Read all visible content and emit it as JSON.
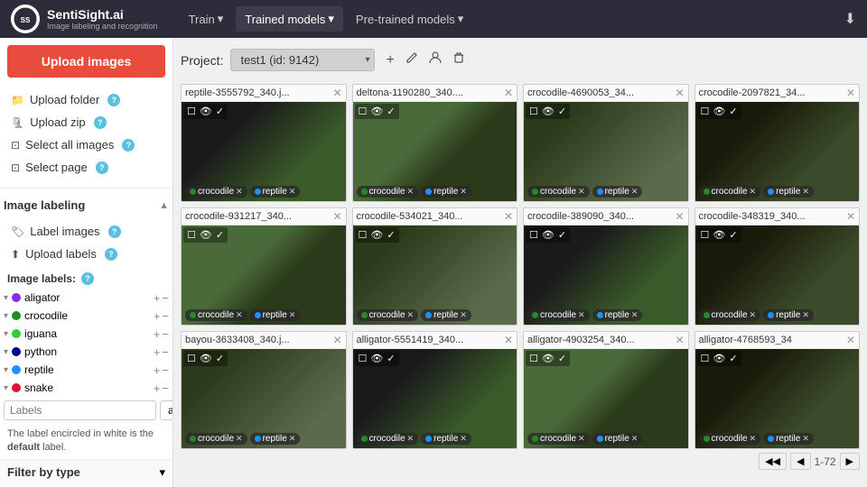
{
  "app": {
    "title": "SentiSight.ai",
    "subtitle": "Image labeling and recognition",
    "logo_text": "SS"
  },
  "navbar": {
    "items": [
      {
        "label": "Train",
        "id": "train",
        "active": false
      },
      {
        "label": "Trained models",
        "id": "trained-models",
        "active": true
      },
      {
        "label": "Pre-trained models",
        "id": "pretrained-models",
        "active": false
      }
    ],
    "download_icon": "⬇"
  },
  "sidebar": {
    "upload_btn": "Upload images",
    "items": [
      {
        "id": "upload-folder",
        "icon": "📁",
        "label": "Upload folder",
        "has_help": true
      },
      {
        "id": "upload-zip",
        "icon": "🗜",
        "label": "Upload zip",
        "has_help": true
      },
      {
        "id": "select-all-images",
        "icon": "⊡",
        "label": "Select all images",
        "has_help": true
      },
      {
        "id": "select-page",
        "icon": "⊡",
        "label": "Select page",
        "has_help": true
      }
    ],
    "image_labeling_section": "Image labeling",
    "label_images": "Label images",
    "upload_labels": "Upload labels",
    "image_labels_header": "Image labels:",
    "labels": [
      {
        "id": "aligator",
        "name": "aligator",
        "color": "#8a2be2"
      },
      {
        "id": "crocodile",
        "name": "crocodile",
        "color": "#228b22"
      },
      {
        "id": "iguana",
        "name": "iguana",
        "color": "#32cd32"
      },
      {
        "id": "python",
        "name": "python",
        "color": "#00008b"
      },
      {
        "id": "reptile",
        "name": "reptile",
        "color": "#1e90ff"
      },
      {
        "id": "snake",
        "name": "snake",
        "color": "#dc143c"
      }
    ],
    "labels_placeholder": "Labels",
    "labels_add_btn": "add",
    "default_label_note": "The label encircled in white is the",
    "default_label_keyword": "default",
    "default_label_note2": "label.",
    "filter_section_label": "Filter by type"
  },
  "project_bar": {
    "label": "Project:",
    "current": "test1 (id: 9142)",
    "add_icon": "+",
    "edit_icon": "✏",
    "user_icon": "👤",
    "delete_icon": "🗑"
  },
  "images": [
    {
      "id": "img1",
      "title": "reptile-3555792_340.j...",
      "bg_class": "img-croc1",
      "tags": [
        {
          "label": "crocodile",
          "color": "#228b22"
        },
        {
          "label": "reptile",
          "color": "#1e90ff"
        }
      ]
    },
    {
      "id": "img2",
      "title": "deltona-1190280_340....",
      "bg_class": "img-croc2",
      "tags": [
        {
          "label": "crocodile",
          "color": "#228b22"
        },
        {
          "label": "reptile",
          "color": "#1e90ff"
        }
      ]
    },
    {
      "id": "img3",
      "title": "crocodile-4690053_34...",
      "bg_class": "img-croc3",
      "tags": [
        {
          "label": "crocodile",
          "color": "#228b22"
        },
        {
          "label": "reptile",
          "color": "#1e90ff"
        }
      ]
    },
    {
      "id": "img4",
      "title": "crocodile-2097821_34...",
      "bg_class": "img-croc4",
      "tags": [
        {
          "label": "crocodile",
          "color": "#228b22"
        },
        {
          "label": "reptile",
          "color": "#1e90ff"
        }
      ]
    },
    {
      "id": "img5",
      "title": "crocodile-931217_340...",
      "bg_class": "img-croc2",
      "tags": [
        {
          "label": "crocodile",
          "color": "#228b22"
        },
        {
          "label": "reptile",
          "color": "#1e90ff"
        }
      ]
    },
    {
      "id": "img6",
      "title": "crocodile-534021_340...",
      "bg_class": "img-croc3",
      "tags": [
        {
          "label": "crocodile",
          "color": "#228b22"
        },
        {
          "label": "reptile",
          "color": "#1e90ff"
        }
      ]
    },
    {
      "id": "img7",
      "title": "crocodile-389090_340...",
      "bg_class": "img-croc1",
      "tags": [
        {
          "label": "crocodile",
          "color": "#228b22"
        },
        {
          "label": "reptile",
          "color": "#1e90ff"
        }
      ]
    },
    {
      "id": "img8",
      "title": "crocodile-348319_340...",
      "bg_class": "img-croc4",
      "tags": [
        {
          "label": "crocodile",
          "color": "#228b22"
        },
        {
          "label": "reptile",
          "color": "#1e90ff"
        }
      ]
    },
    {
      "id": "img9",
      "title": "bayou-3633408_340.j...",
      "bg_class": "img-croc3",
      "tags": [
        {
          "label": "crocodile",
          "color": "#228b22"
        },
        {
          "label": "reptile",
          "color": "#1e90ff"
        }
      ]
    },
    {
      "id": "img10",
      "title": "alligator-5551419_340...",
      "bg_class": "img-croc1",
      "tags": [
        {
          "label": "crocodile",
          "color": "#228b22"
        },
        {
          "label": "reptile",
          "color": "#1e90ff"
        }
      ]
    },
    {
      "id": "img11",
      "title": "alligator-4903254_340...",
      "bg_class": "img-croc2",
      "tags": [
        {
          "label": "crocodile",
          "color": "#228b22"
        },
        {
          "label": "reptile",
          "color": "#1e90ff"
        }
      ]
    },
    {
      "id": "img12",
      "title": "alligator-4768593_34",
      "bg_class": "img-croc4",
      "tags": [
        {
          "label": "crocodile",
          "color": "#228b22"
        },
        {
          "label": "reptile",
          "color": "#1e90ff"
        }
      ]
    }
  ],
  "pagination": {
    "prev_icon": "◀◀",
    "prev_label": "◀",
    "range": "1-72",
    "next_label": "▶"
  }
}
